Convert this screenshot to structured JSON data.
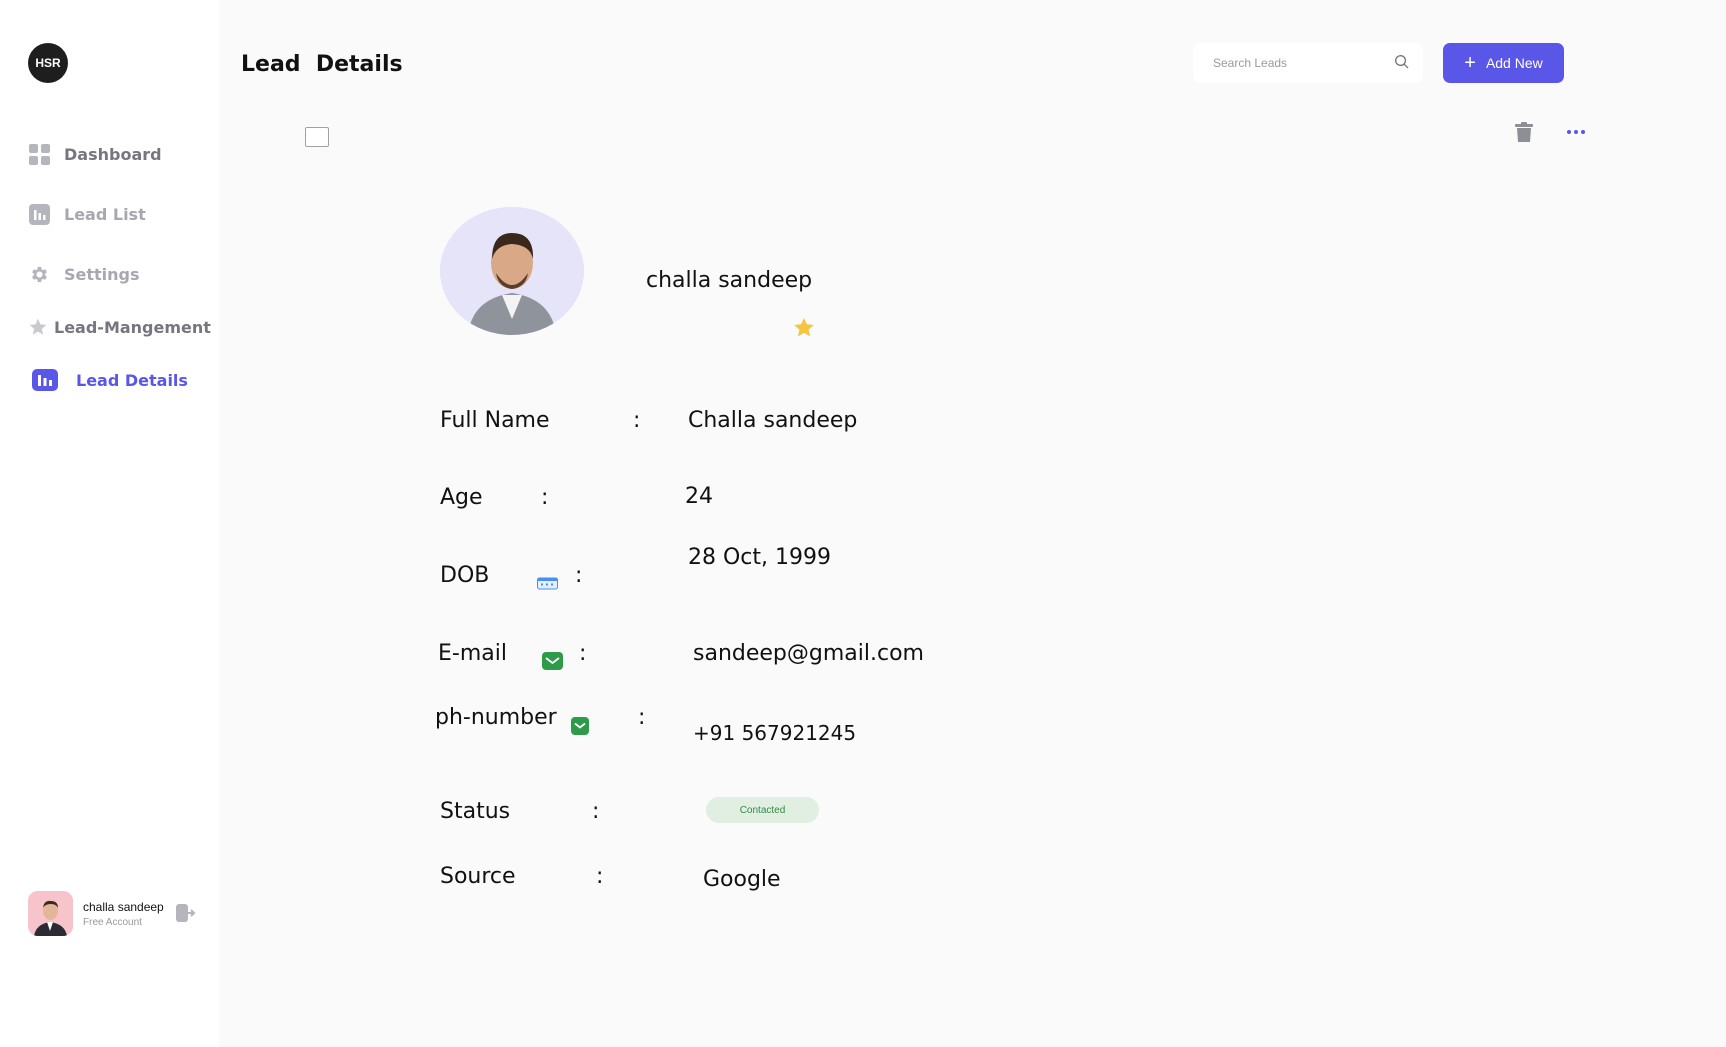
{
  "brand": {
    "logo_text": "HSR"
  },
  "sidebar": {
    "items": [
      {
        "label": "Dashboard"
      },
      {
        "label": "Lead List"
      },
      {
        "label": "Settings"
      },
      {
        "label": "Lead-Mangement"
      },
      {
        "label": "Lead Details"
      }
    ],
    "active": "Lead Details"
  },
  "user": {
    "name": "challa sandeep",
    "plan": "Free Account"
  },
  "header": {
    "title": "Lead  Details",
    "search_placeholder": "Search Leads",
    "add_label": "Add New"
  },
  "profile": {
    "name": "challa sandeep"
  },
  "details": {
    "full_name": {
      "label": "Full Name",
      "value": "Challa sandeep"
    },
    "age": {
      "label": "Age",
      "value": "24"
    },
    "dob": {
      "label": "DOB",
      "value": "28 Oct, 1999"
    },
    "email": {
      "label": "E-mail",
      "value": "sandeep@gmail.com"
    },
    "phone": {
      "label": "ph-number",
      "value": "+91 567921245"
    },
    "status": {
      "label": "Status",
      "value": "Contacted"
    },
    "source": {
      "label": "Source",
      "value": "Google"
    },
    "separator": ":"
  },
  "colors": {
    "accent": "#5a56e8",
    "status_bg": "#e1efe3",
    "status_text": "#2f8a43",
    "star": "#f5c542"
  }
}
